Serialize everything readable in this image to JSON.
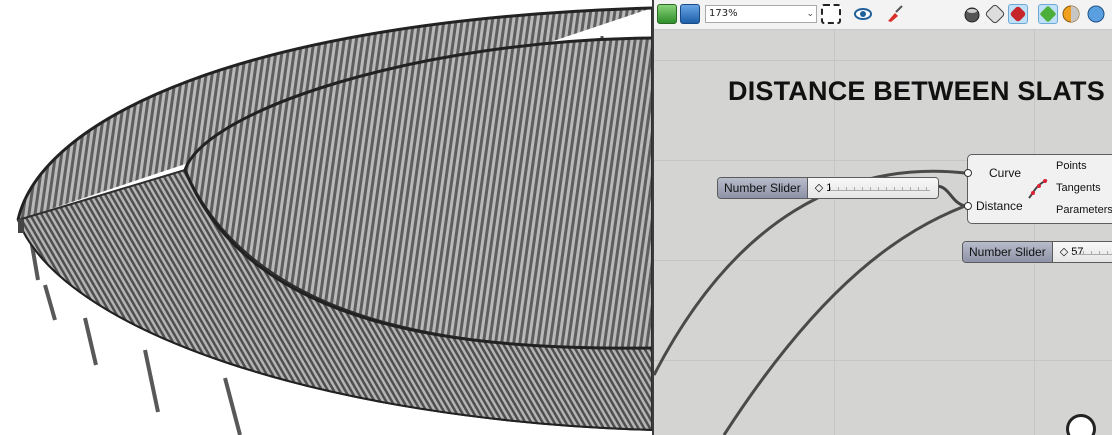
{
  "toolbar": {
    "zoom": "173%",
    "icons": [
      "open-file-icon",
      "save-file-icon",
      "zoom-dropdown",
      "zoom-extents-icon",
      "preview-eye-icon",
      "paint-brush-icon",
      "preview-shaded-icon",
      "preview-wire-icon",
      "preview-render-icon",
      "preview-selected-icon",
      "sphere-material-icon",
      "globe-icon"
    ]
  },
  "canvas": {
    "title": "DISTANCE BETWEEN SLATS",
    "slider1": {
      "name": "Number Slider",
      "value": "1"
    },
    "slider2": {
      "name": "Number Slider",
      "value": "57"
    },
    "component": {
      "inputs": [
        "Curve",
        "Distance"
      ],
      "outputs": [
        "Points",
        "Tangents",
        "Parameters"
      ]
    }
  },
  "colors": {
    "canvas_bg": "#d4d4d2",
    "slider_header": "#9ea2b4",
    "wire": "#4a4a4a"
  }
}
